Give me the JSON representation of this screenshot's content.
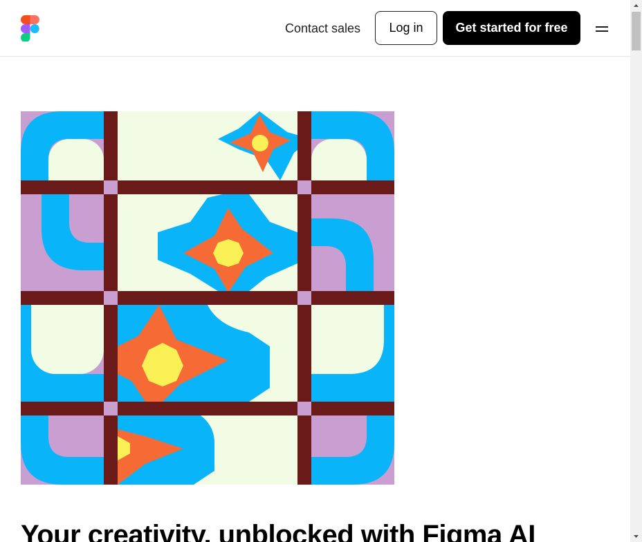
{
  "header": {
    "contact_sales": "Contact sales",
    "login_label": "Log in",
    "cta_label": "Get started for free",
    "menu_icon": "hamburger-menu-icon",
    "logo_icon": "figma-logo-icon"
  },
  "hero": {
    "image": "abstract-tile-pattern-illustration",
    "headline": "Your creativity, unblocked with Figma AI"
  },
  "colors": {
    "logo_red": "#f24e1e",
    "logo_orange": "#ff7262",
    "logo_purple": "#a259ff",
    "logo_blue": "#1abcfe",
    "logo_green": "#0acf83",
    "art_lilac": "#c99fd2",
    "art_blue": "#0ab4f8",
    "art_cream": "#f2fbe3",
    "art_maroon": "#6b1a1a",
    "art_orange": "#f56a35",
    "art_yellow": "#f8f055"
  }
}
